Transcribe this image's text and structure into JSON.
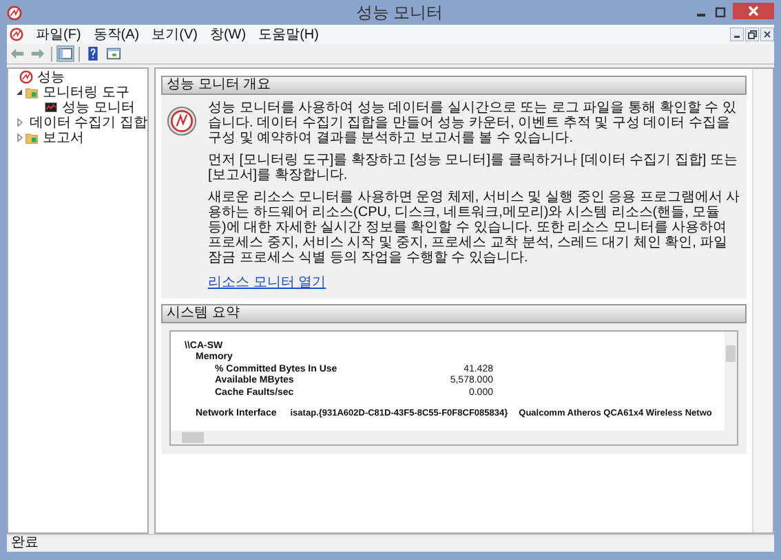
{
  "window": {
    "title": "성능 모니터"
  },
  "menu": [
    "파일(F)",
    "동작(A)",
    "보기(V)",
    "창(W)",
    "도움말(H)"
  ],
  "tree": [
    {
      "label": "성능",
      "children": [
        {
          "label": "모니터링 도구",
          "expanded": true,
          "children": [
            {
              "label": "성능 모니터"
            }
          ]
        },
        {
          "label": "데이터 수집기 집합",
          "expanded": false
        },
        {
          "label": "보고서",
          "expanded": false
        }
      ]
    }
  ],
  "overview": {
    "title": "성능 모니터 개요",
    "paragraphs": [
      "성능 모니터를 사용하여 성능 데이터를 실시간으로 또는 로그 파일을 통해 확인할 수 있습니다. 데이터 수집기 집합을 만들어 성능 카운터, 이벤트 추적 및 구성 데이터 수집을 구성 및 예약하여 결과를 분석하고 보고서를 볼 수 있습니다.",
      "먼저 [모니터링 도구]를 확장하고 [성능 모니터]를 클릭하거나 [데이터 수집기 집합] 또는 [보고서]를 확장합니다.",
      "새로운 리소스 모니터를 사용하면 운영 체제, 서비스 및 실행 중인 응용 프로그램에서 사용하는 하드웨어 리소스(CPU, 디스크, 네트워크,메모리)와 시스템 리소스(핸들, 모듈 등)에 대한 자세한 실시간 정보를 확인할 수 있습니다. 또한 리소스 모니터를 사용하여 프로세스 중지, 서비스 시작 및 중지, 프로세스 교착 분석, 스레드 대기 체인 확인, 파일 잠금 프로세스 식별 등의 작업을 수행할 수 있습니다."
    ],
    "link": "리소스 모니터 열기"
  },
  "summary": {
    "title": "시스템 요약",
    "host": "\\\\CA-SW",
    "sections": [
      {
        "name": "Memory",
        "rows": [
          {
            "label": "% Committed Bytes In Use",
            "value": "41.428"
          },
          {
            "label": "Available MBytes",
            "value": "5,578.000"
          },
          {
            "label": "Cache Faults/sec",
            "value": "0.000"
          }
        ]
      },
      {
        "name": "Network Interface",
        "columns": [
          "isatap.{931A602D-C81D-43F5-8C55-F0F8CF085834}",
          "Qualcomm Atheros QCA61x4 Wireless Netwo"
        ]
      }
    ]
  },
  "status_bar": "완료"
}
